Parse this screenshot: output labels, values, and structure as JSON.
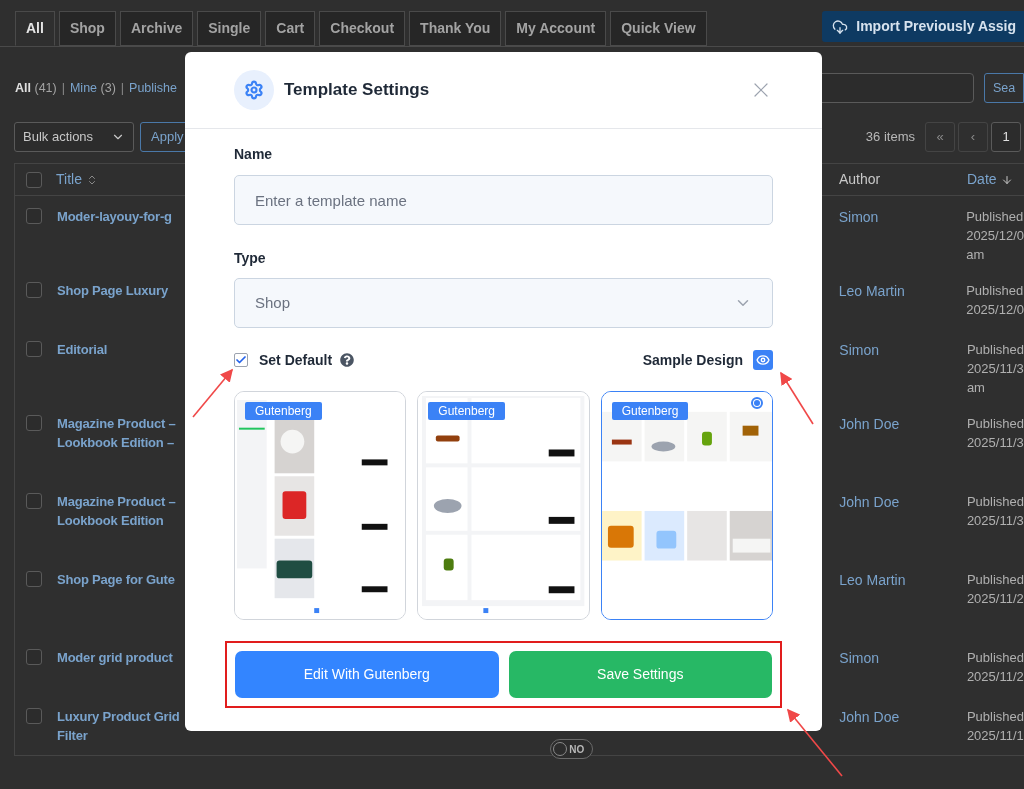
{
  "background_page": {
    "tabs": [
      {
        "label": "All",
        "selected": true
      },
      {
        "label": "Shop",
        "selected": false
      },
      {
        "label": "Archive",
        "selected": false
      },
      {
        "label": "Single",
        "selected": false
      },
      {
        "label": "Cart",
        "selected": false
      },
      {
        "label": "Checkout",
        "selected": false
      },
      {
        "label": "Thank You",
        "selected": false
      },
      {
        "label": "My Account",
        "selected": false
      },
      {
        "label": "Quick View",
        "selected": false
      }
    ],
    "import_button": "Import Previously Assig",
    "filters": [
      {
        "label": "All",
        "count": "(41)",
        "separator": "|",
        "selected": true
      },
      {
        "label": "Mine",
        "count": "(3)",
        "separator": "|",
        "selected": false
      },
      {
        "label": "Publishe",
        "selected": false
      }
    ],
    "search_button": "Sea",
    "bulk_actions": "Bulk actions",
    "apply_button": "Apply",
    "items_count": "36 items",
    "pagination": [
      "«",
      "‹",
      "1"
    ],
    "select_all_checked": false,
    "columns": [
      {
        "label": "Title",
        "sorted": false
      },
      {
        "label": "Author",
        "sorted": false
      },
      {
        "label": "Date",
        "sorted": true
      }
    ],
    "rows": [
      {
        "checked": false,
        "title": [
          "Moder-layouy-for-g"
        ],
        "author": "Simon",
        "date": [
          "Published",
          "2025/12/0",
          "am"
        ]
      },
      {
        "checked": false,
        "title": [
          "Shop Page Luxury"
        ],
        "author": "Leo Martin",
        "date": [
          "Published",
          "2025/12/0"
        ]
      },
      {
        "checked": false,
        "title": [
          "Editorial"
        ],
        "author": "Simon",
        "date": [
          "Published",
          "2025/11/3",
          "am"
        ]
      },
      {
        "checked": false,
        "title": [
          "Magazine Product –",
          "Lookbook Edition –"
        ],
        "author": "John Doe",
        "date": [
          "Published",
          "2025/11/3"
        ]
      },
      {
        "checked": false,
        "title": [
          "Magazine Product –",
          "Lookbook Edition"
        ],
        "author": "John Doe",
        "date": [
          "Published",
          "2025/11/3"
        ]
      },
      {
        "checked": false,
        "title": [
          "Shop Page for Gute"
        ],
        "author": "Leo Martin",
        "date": [
          "Published",
          "2025/11/2"
        ]
      },
      {
        "checked": false,
        "title": [
          "Moder grid product"
        ],
        "author": "Simon",
        "date": [
          "Published",
          "2025/11/2"
        ]
      },
      {
        "checked": false,
        "title": [
          "Luxury Product Grid",
          "Filter"
        ],
        "author": "John Doe",
        "date": [
          "Published",
          "2025/11/1"
        ],
        "toggle": {
          "label": "NO",
          "on": false
        }
      }
    ]
  },
  "modal": {
    "title": "Template Settings",
    "name_field": {
      "label": "Name",
      "placeholder": "Enter a template name"
    },
    "type_field": {
      "label": "Type",
      "value": "Shop"
    },
    "set_default": {
      "label": "Set Default",
      "checked": true
    },
    "sample_design": {
      "label": "Sample Design",
      "on": true
    },
    "designs": [
      {
        "badge": "Gutenberg",
        "selected": false
      },
      {
        "badge": "Gutenberg",
        "selected": false
      },
      {
        "badge": "Gutenberg",
        "selected": true
      }
    ],
    "buttons": [
      {
        "label": "Edit With Gutenberg",
        "kind": "primary"
      },
      {
        "label": "Save Settings",
        "kind": "success"
      }
    ]
  }
}
